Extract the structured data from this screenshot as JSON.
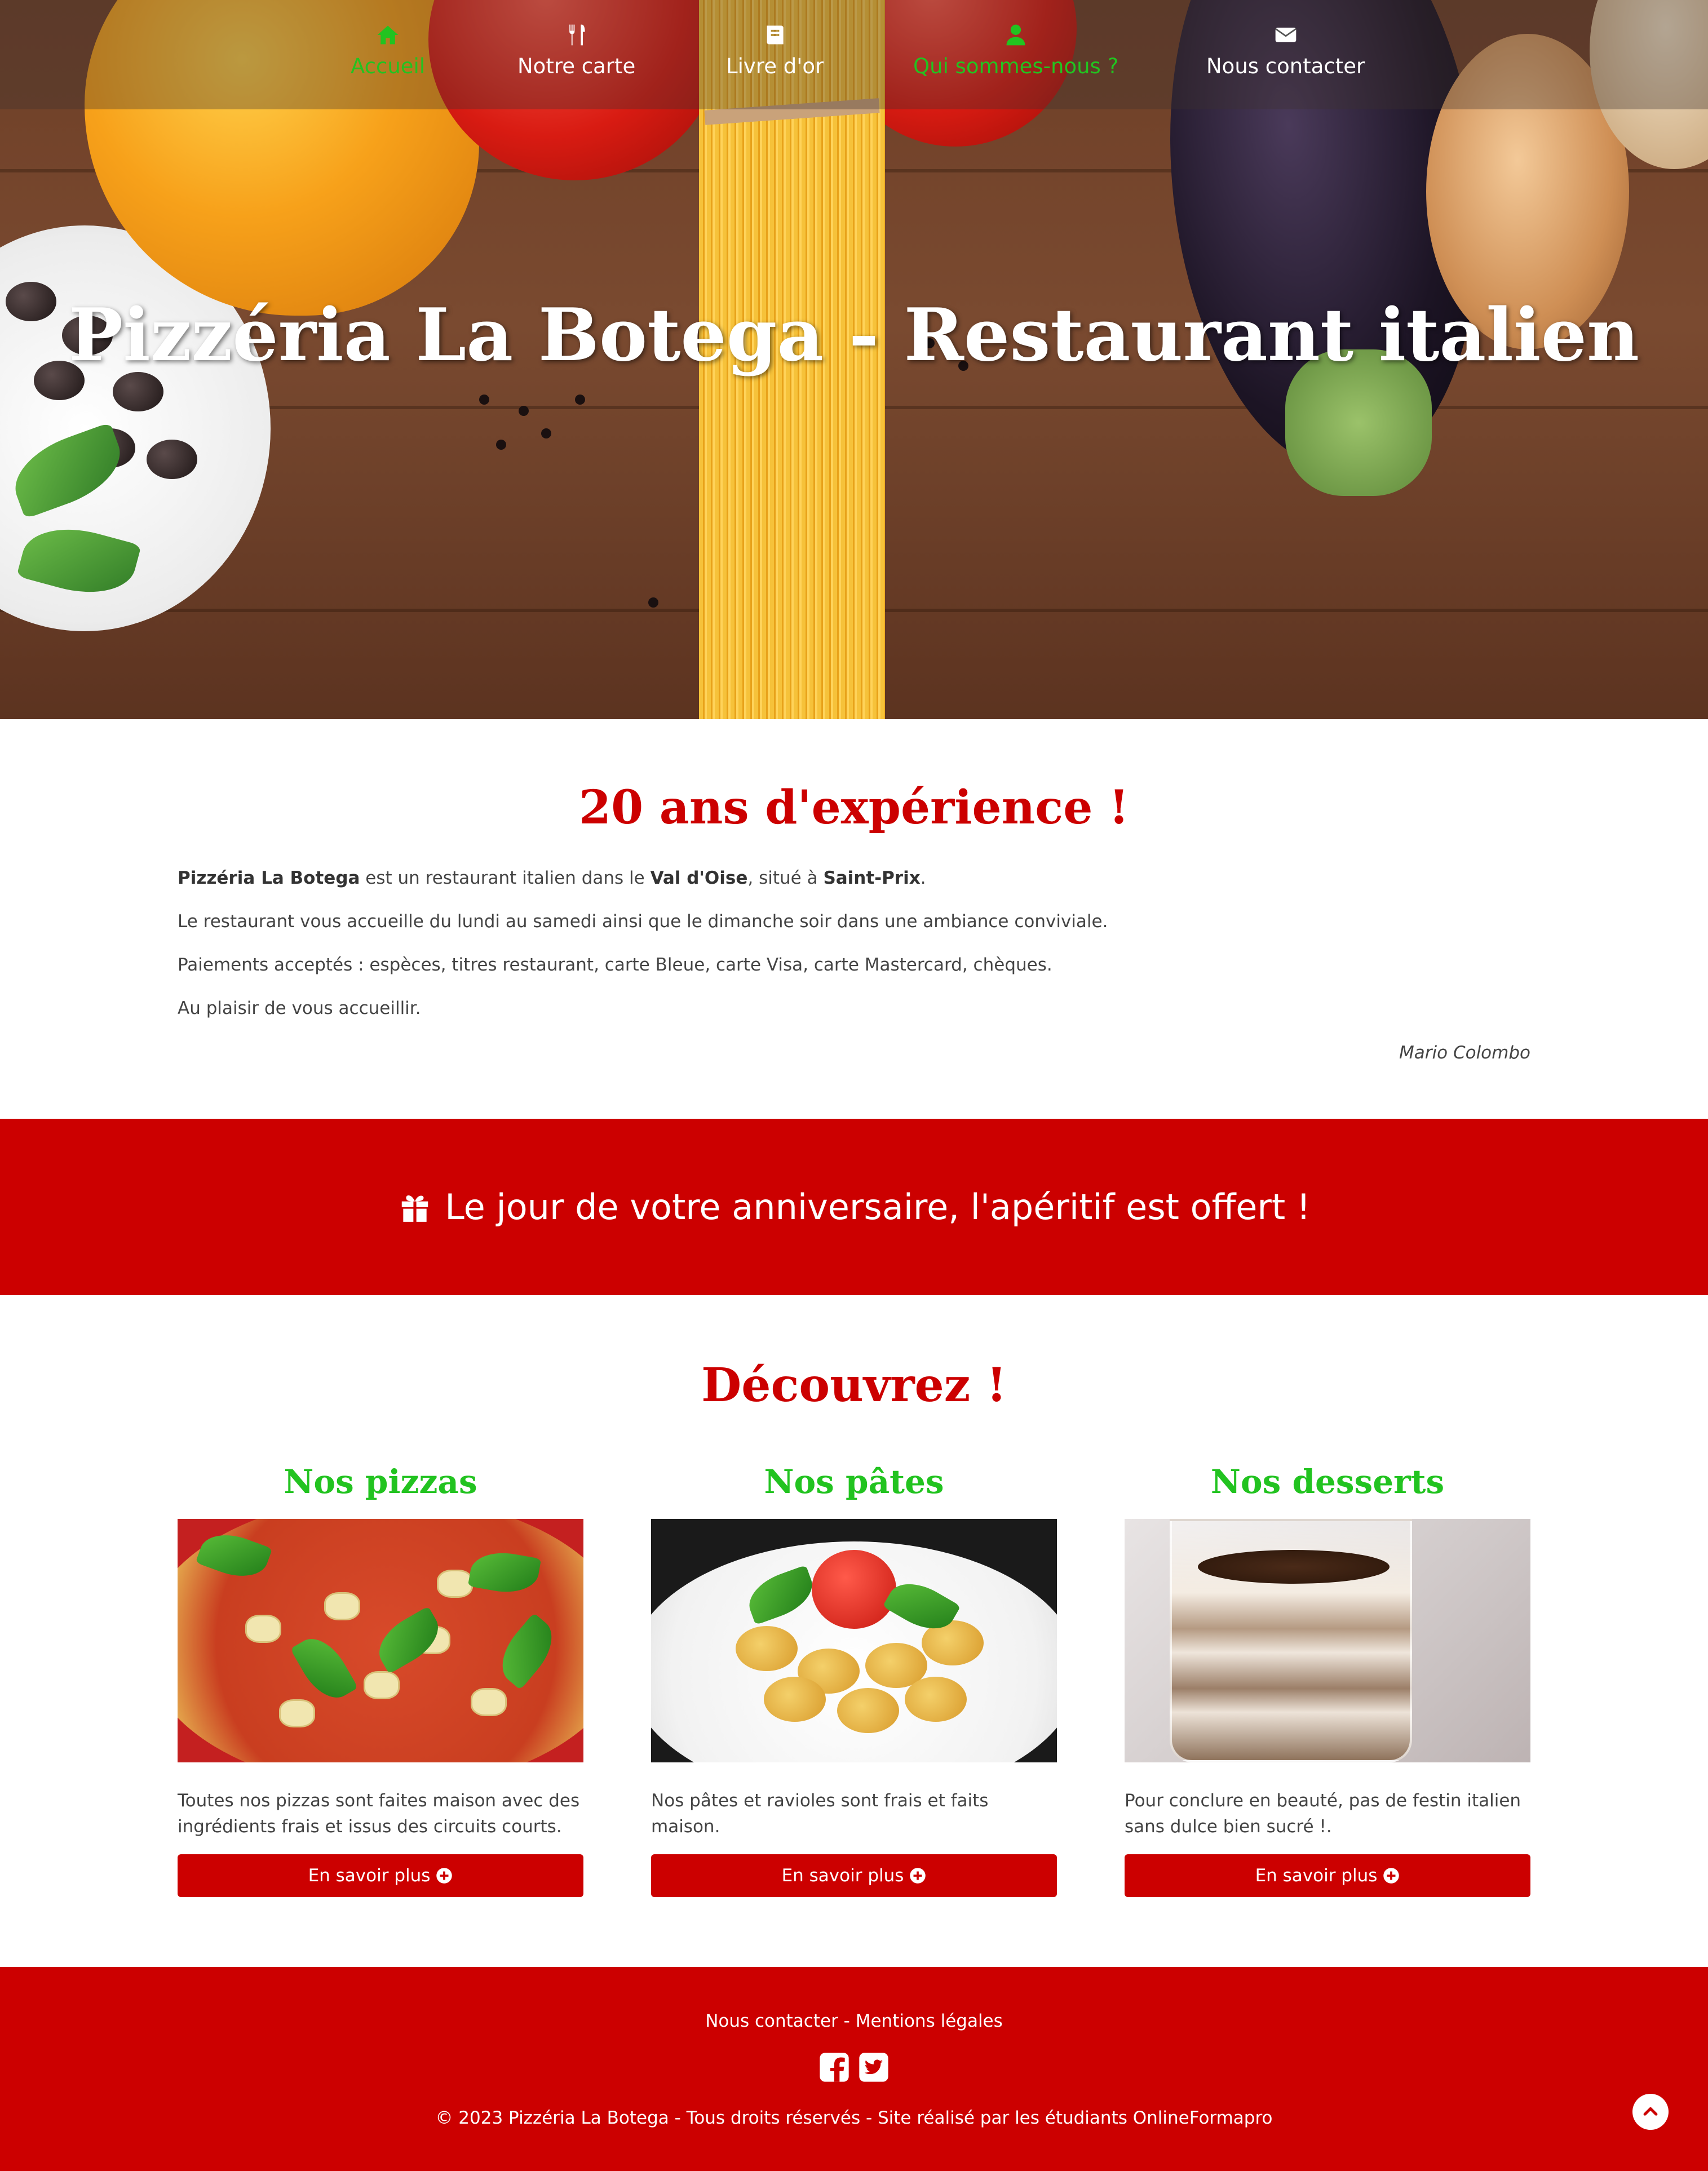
{
  "nav": {
    "items": [
      {
        "label": "Accueil",
        "icon": "home-icon",
        "active": true
      },
      {
        "label": "Notre carte",
        "icon": "fork-knife-icon"
      },
      {
        "label": "Livre d'or",
        "icon": "book-icon"
      },
      {
        "label": "Qui sommes-nous ?",
        "icon": "user-icon",
        "active": true
      },
      {
        "label": "Nous contacter",
        "icon": "envelope-icon"
      }
    ]
  },
  "hero": {
    "title": "Pizzéria La Botega - Restaurant italien"
  },
  "intro": {
    "heading": "20 ans d'expérience !",
    "p1": {
      "name": "Pizzéria La Botega",
      "t1": " est un restaurant italien dans le ",
      "region": "Val d'Oise",
      "t2": ", situé à ",
      "city": "Saint-Prix",
      "t3": "."
    },
    "p2": "Le restaurant vous accueille du lundi au samedi ainsi que le dimanche soir dans une ambiance conviviale.",
    "p3": "Paiements acceptés : espèces, titres restaurant, carte Bleue, carte Visa, carte Mastercard, chèques.",
    "p4": "Au plaisir de vous accueillir.",
    "signature": "Mario Colombo"
  },
  "promo": {
    "text": "Le jour de votre anniversaire, l'apéritif est offert !",
    "icon": "gift-icon"
  },
  "discover": {
    "heading": "Découvrez !",
    "cards": [
      {
        "title": "Nos pizzas",
        "text": "Toutes nos pizzas sont faites maison avec des ingrédients frais et issus des circuits courts.",
        "button": "En savoir plus"
      },
      {
        "title": "Nos pâtes",
        "text": "Nos pâtes et ravioles sont frais et faits maison.",
        "button": "En savoir plus"
      },
      {
        "title": "Nos desserts",
        "text": "Pour conclure en beauté, pas de festin italien sans dulce bien sucré !.",
        "button": "En savoir plus"
      }
    ]
  },
  "footer": {
    "contact": "Nous contacter",
    "separator": " - ",
    "legal": "Mentions légales",
    "social": [
      "facebook-icon",
      "twitter-icon"
    ],
    "copyright": "© 2023 Pizzéria La Botega - Tous droits réservés - Site réalisé par les étudiants OnlineFormapro"
  },
  "colors": {
    "accent": "#cc0000",
    "green": "#22c320",
    "text": "#444444"
  }
}
